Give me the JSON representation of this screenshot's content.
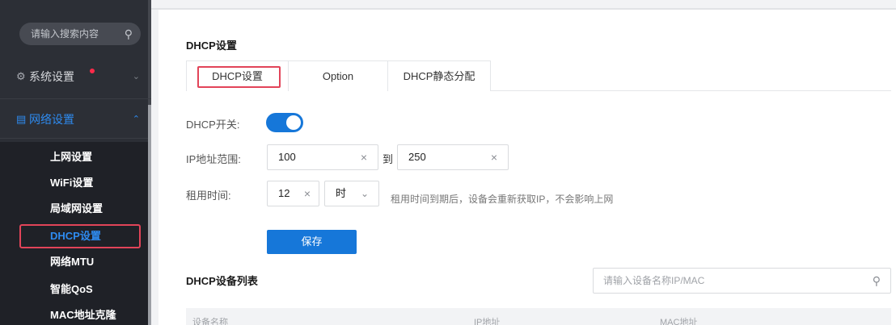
{
  "sidebar": {
    "search_placeholder": "请输入搜索内容",
    "search_icon": "magnifier",
    "groups": [
      {
        "label": "系统设置",
        "icon": "gear",
        "expanded": false,
        "has_dot": true
      },
      {
        "label": "网络设置",
        "icon": "document",
        "expanded": true
      }
    ],
    "items": [
      {
        "label": "上网设置"
      },
      {
        "label": "WiFi设置"
      },
      {
        "label": "局域网设置"
      },
      {
        "label": "DHCP设置",
        "active": true
      },
      {
        "label": "网络MTU"
      },
      {
        "label": "智能QoS"
      },
      {
        "label": "MAC地址克隆"
      }
    ]
  },
  "main": {
    "title": "DHCP设置",
    "tabs": [
      {
        "label": "DHCP设置",
        "active": true
      },
      {
        "label": "Option"
      },
      {
        "label": "DHCP静态分配"
      }
    ],
    "form": {
      "switch_label": "DHCP开关:",
      "switch_on": true,
      "range_label": "IP地址范围:",
      "range_start": "100",
      "range_to": "到",
      "range_end": "250",
      "lease_label": "租用时间:",
      "lease_value": "12",
      "lease_unit": "时",
      "lease_hint": "租用时间到期后，设备会重新获取IP，不会影响上网",
      "save_label": "保存"
    },
    "device_list": {
      "title": "DHCP设备列表",
      "search_placeholder": "请输入设备名称IP/MAC",
      "columns": [
        "设备名称",
        "IP地址",
        "MAC地址"
      ]
    }
  },
  "colors": {
    "accent": "#1677d9",
    "highlight_border": "#e24459",
    "sidebar_bg": "#2c2f36"
  }
}
